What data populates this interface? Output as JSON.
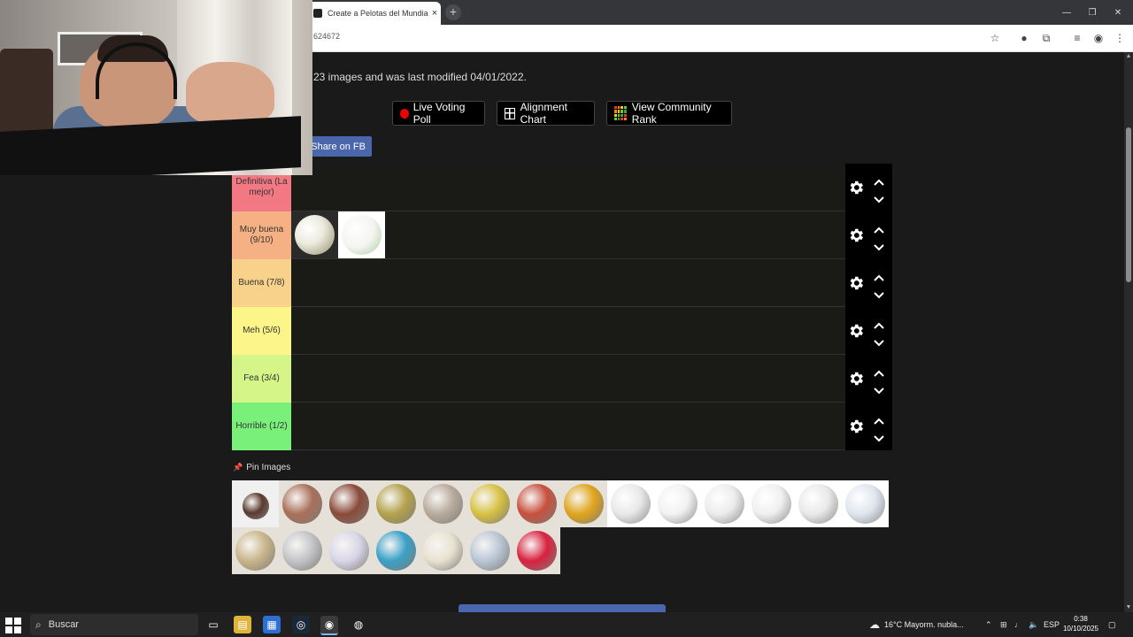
{
  "browser": {
    "tab_title": "Create a Pelotas del Mundial (L",
    "tab_close": "×",
    "new_tab": "+",
    "url": "624672",
    "window": {
      "minimize": "—",
      "restore": "❐",
      "close": "✕"
    }
  },
  "page": {
    "info_text": "23 images and was last modified 04/01/2022.",
    "buttons": {
      "live_voting": "Live Voting Poll",
      "alignment": "Alignment Chart",
      "community": "View Community Rank"
    },
    "share_fb": "Share on FB",
    "tiers": [
      {
        "label": "Definitiva (La mejor)",
        "color": "#f27884",
        "items": []
      },
      {
        "label": "Muy buena (9/10)",
        "color": "#f5b084",
        "items": [
          "brazuca-gold",
          "brazuca"
        ]
      },
      {
        "label": "Buena (7/8)",
        "color": "#f8d18a",
        "items": []
      },
      {
        "label": "Meh (5/6)",
        "color": "#fcf58a",
        "items": []
      },
      {
        "label": "Fea (3/4)",
        "color": "#d6f588",
        "items": []
      },
      {
        "label": "Horrible (1/2)",
        "color": "#79f07a",
        "items": []
      }
    ],
    "pin_images": "Pin Images",
    "pool": [
      {
        "name": "ball-1930",
        "color": "#5a3a2e"
      },
      {
        "name": "ball-1934",
        "color": "#a9705a"
      },
      {
        "name": "ball-1938",
        "color": "#8a4a3a"
      },
      {
        "name": "ball-1950",
        "color": "#b4a24c"
      },
      {
        "name": "ball-1954",
        "color": "#b8ab9c"
      },
      {
        "name": "ball-1958",
        "color": "#d7c243"
      },
      {
        "name": "ball-1962",
        "color": "#c8503e"
      },
      {
        "name": "ball-1966",
        "color": "#e0a51c"
      },
      {
        "name": "ball-1970",
        "color": "#e8e8e8"
      },
      {
        "name": "ball-1974",
        "color": "#f2f2f2"
      },
      {
        "name": "ball-1978",
        "color": "#ececec"
      },
      {
        "name": "ball-1982",
        "color": "#f0f0f0"
      },
      {
        "name": "ball-1986",
        "color": "#e9e9e9"
      },
      {
        "name": "ball-1990",
        "color": "#dfe6ee"
      },
      {
        "name": "ball-1994",
        "color": "#c9b58a"
      },
      {
        "name": "ball-1998",
        "color": "#c4c4c8"
      },
      {
        "name": "ball-2002",
        "color": "#d9d6e8"
      },
      {
        "name": "ball-2006",
        "color": "#3aa0c8"
      },
      {
        "name": "ball-2010",
        "color": "#e8e2d0"
      },
      {
        "name": "ball-2014",
        "color": "#b9c6d6"
      },
      {
        "name": "ball-2018",
        "color": "#d8223f"
      }
    ]
  },
  "taskbar": {
    "search": "Buscar",
    "weather": "16°C  Mayorm. nubla...",
    "lang": "ESP",
    "time": "0:38",
    "date": "10/10/2025"
  }
}
